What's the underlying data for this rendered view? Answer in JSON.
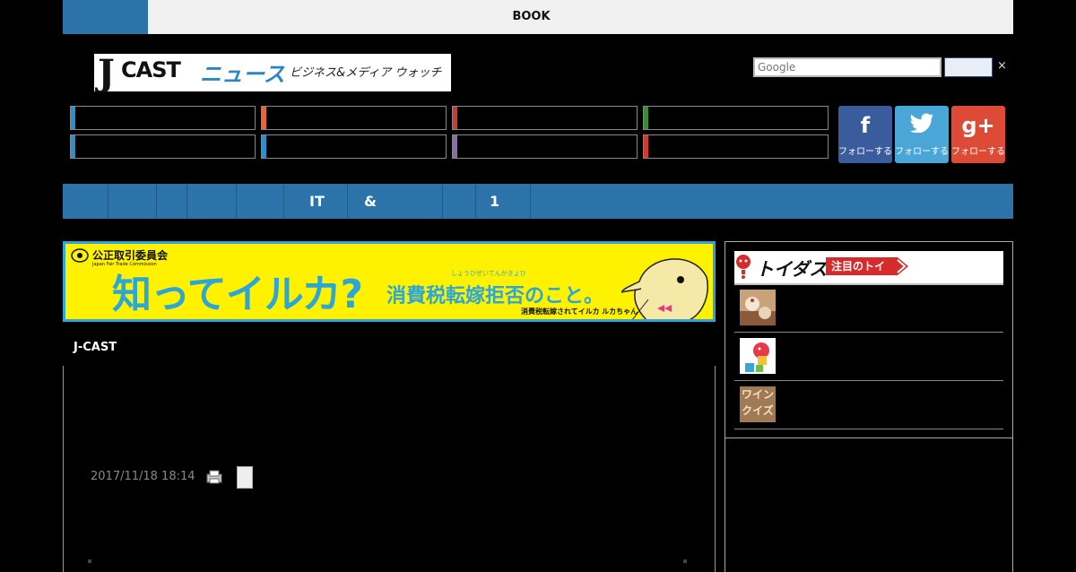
{
  "topbar": {
    "label": "BOOK",
    "accent": "#2b73a8"
  },
  "logo": {
    "j": "J",
    "cast": "CAST",
    "news": "ニュース",
    "tagline": "ビジネス&メディア ウォッチ"
  },
  "search": {
    "placeholder": "Google",
    "close": "×"
  },
  "categories": {
    "bar_colors": [
      "#2a8fd0",
      "#e8643c",
      "#d03a2c",
      "#3a8a3a",
      "#2a8fd0",
      "#2a8fd0",
      "#8a6cae",
      "#d03a2c"
    ]
  },
  "social": [
    {
      "icon": "f",
      "label": "フォローする",
      "color": "#3b5c9c"
    },
    {
      "icon": "t",
      "label": "フォローする",
      "color": "#4aa6d6"
    },
    {
      "icon": "g+",
      "label": "フォローする",
      "color": "#dd4a36"
    }
  ],
  "nav": {
    "items": [
      "IT",
      "&",
      "1"
    ]
  },
  "ad": {
    "org": "公正取引委員会",
    "org_en": "Japan Fair Trade Commission",
    "headline": "知ってイルカ?",
    "sub": "消費税転嫁拒否のこと。",
    "ruby": "しょうひぜいてんかきょひ",
    "small": "消費税転嫁されてイルカ ルカちゃん"
  },
  "article": {
    "source": "J-CAST",
    "timestamp": "2017/11/18 18:14"
  },
  "sidebar": {
    "logo": "トイダス",
    "tag": "注目のトイ",
    "items": [
      {
        "thumb": "cake-thumbnail"
      },
      {
        "thumb": "mascot-thumbnail"
      },
      {
        "thumb": "wine-quiz-thumbnail",
        "text": "ワインクイズ"
      }
    ]
  }
}
